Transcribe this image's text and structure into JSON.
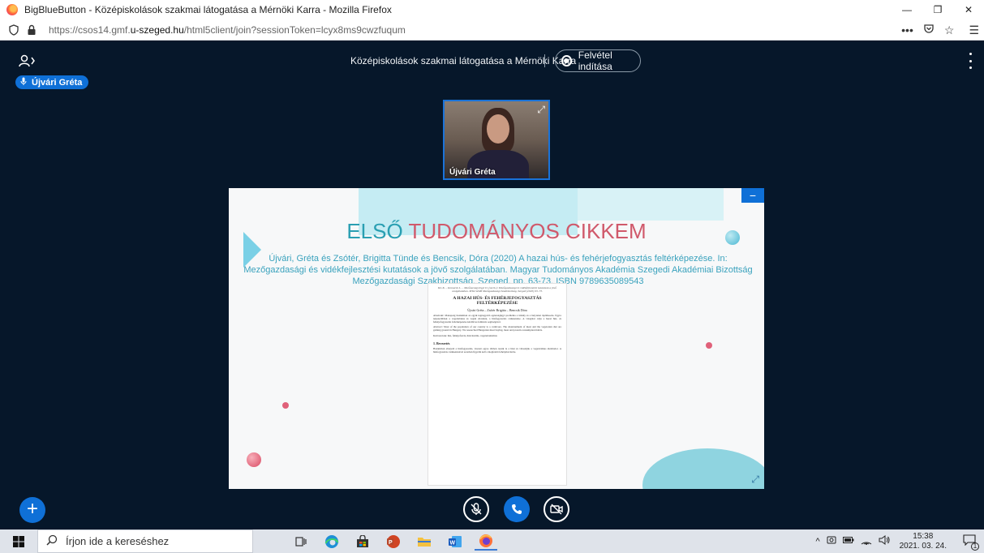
{
  "browser": {
    "window_title": "BigBlueButton - Középiskolások szakmai látogatása a Mérnöki Karra - Mozilla Firefox",
    "url_prefix": "https://csos14.gmf.",
    "url_domain": "u-szeged.hu",
    "url_suffix": "/html5client/join?sessionToken=lcyx8ms9cwzfuqum",
    "window_controls": {
      "minimize": "—",
      "restore": "❐",
      "close": "✕"
    },
    "toolbar_icons": [
      "more-icon",
      "pocket-icon",
      "star-icon",
      "menu-icon"
    ]
  },
  "meeting": {
    "title": "Középiskolások szakmai látogatása a Mérnöki Karra",
    "record_label": "Felvétel indítása",
    "talker_name": "Újvári Gréta"
  },
  "webcam": {
    "name": "Újvári Gréta"
  },
  "slide": {
    "title_part1": "ELSŐ ",
    "title_part2": "TUDOMÁNYOS CIKKEM",
    "citation": "Újvári, Gréta és Zsótér, Brigitta Tünde és Bencsik, Dóra (2020) A hazai hús- és fehérjefogyasztás feltérképezése. In: Mezőgazdasági és vidékfejlesztési kutatások a jövő szolgálatában. Magyar Tudományos Akadémia Szegedi Akadémiai Bizottság Mezőgazdasági Szakbizottság, Szeged, pp. 63-73. ISBN 9789635089543",
    "minimize_label": "−",
    "paper": {
      "header": "Kis K. – Komarek L. – Mezőszentgyörgyi D. (szerk.): Mezőgazdasági és vidékfejlesztési kutatások a jövő szolgálatában. MTA SZAB Mezőgazdasági Szakbizottság, Szeged (2020) 63–73.",
      "title": "A HAZAI HÚS- ÉS FEHÉRJEFOGYASZTÁS FELTÉRKÉPEZÉSE",
      "authors": "Újvári Gréta – Zsótér Brigitta – Bencsik Dóra",
      "abstract_hu": "Absztrakt: Manapság hazánkban az egyik legnagyobb egészségügyi probléma a túlsúly és a helytelen táplálkozás. Egyre népszerűbbek a vegetáriánus és vegán étrendek, a húsfogyasztás csökkentése. A vizsgálat célja a hazai hús- és fehérjefogyasztás feltérképezése kérdőíves felmérés segítségével.",
      "abstract_en": "Abstract: Most of the population of our country is a carnivore. The abandonment of meat and the vegetarian diet are gaining ground in Hungary. We researched Hungarian meat buying, meat and protein consumption habits.",
      "keywords": "Kulcsszavak: hús, fehérjeforrás, húsvásárlás, vegetarianizmus",
      "section": "1. Bevezetés",
      "intro": "Hazánkban elterjedt a húsfogyasztás, viszont egyre többen teszik le a húst és választják a vegetáriánus életmódot. A húsfogyasztás csökkenésével azonban figyelni kell a megfelelő fehérjebevitelre."
    }
  },
  "controls": {
    "actions_label": "+",
    "mic": "mic-muted-icon",
    "audio": "phone-icon",
    "video": "video-off-icon"
  },
  "taskbar": {
    "search_placeholder": "Írjon ide a kereséshez",
    "time": "15:38",
    "date": "2021. 03. 24.",
    "notification_count": "1"
  },
  "colors": {
    "app_bg": "#06172a",
    "primary": "#0f70d7",
    "slide_teal": "#2a9fb2",
    "slide_red": "#d0596b"
  }
}
